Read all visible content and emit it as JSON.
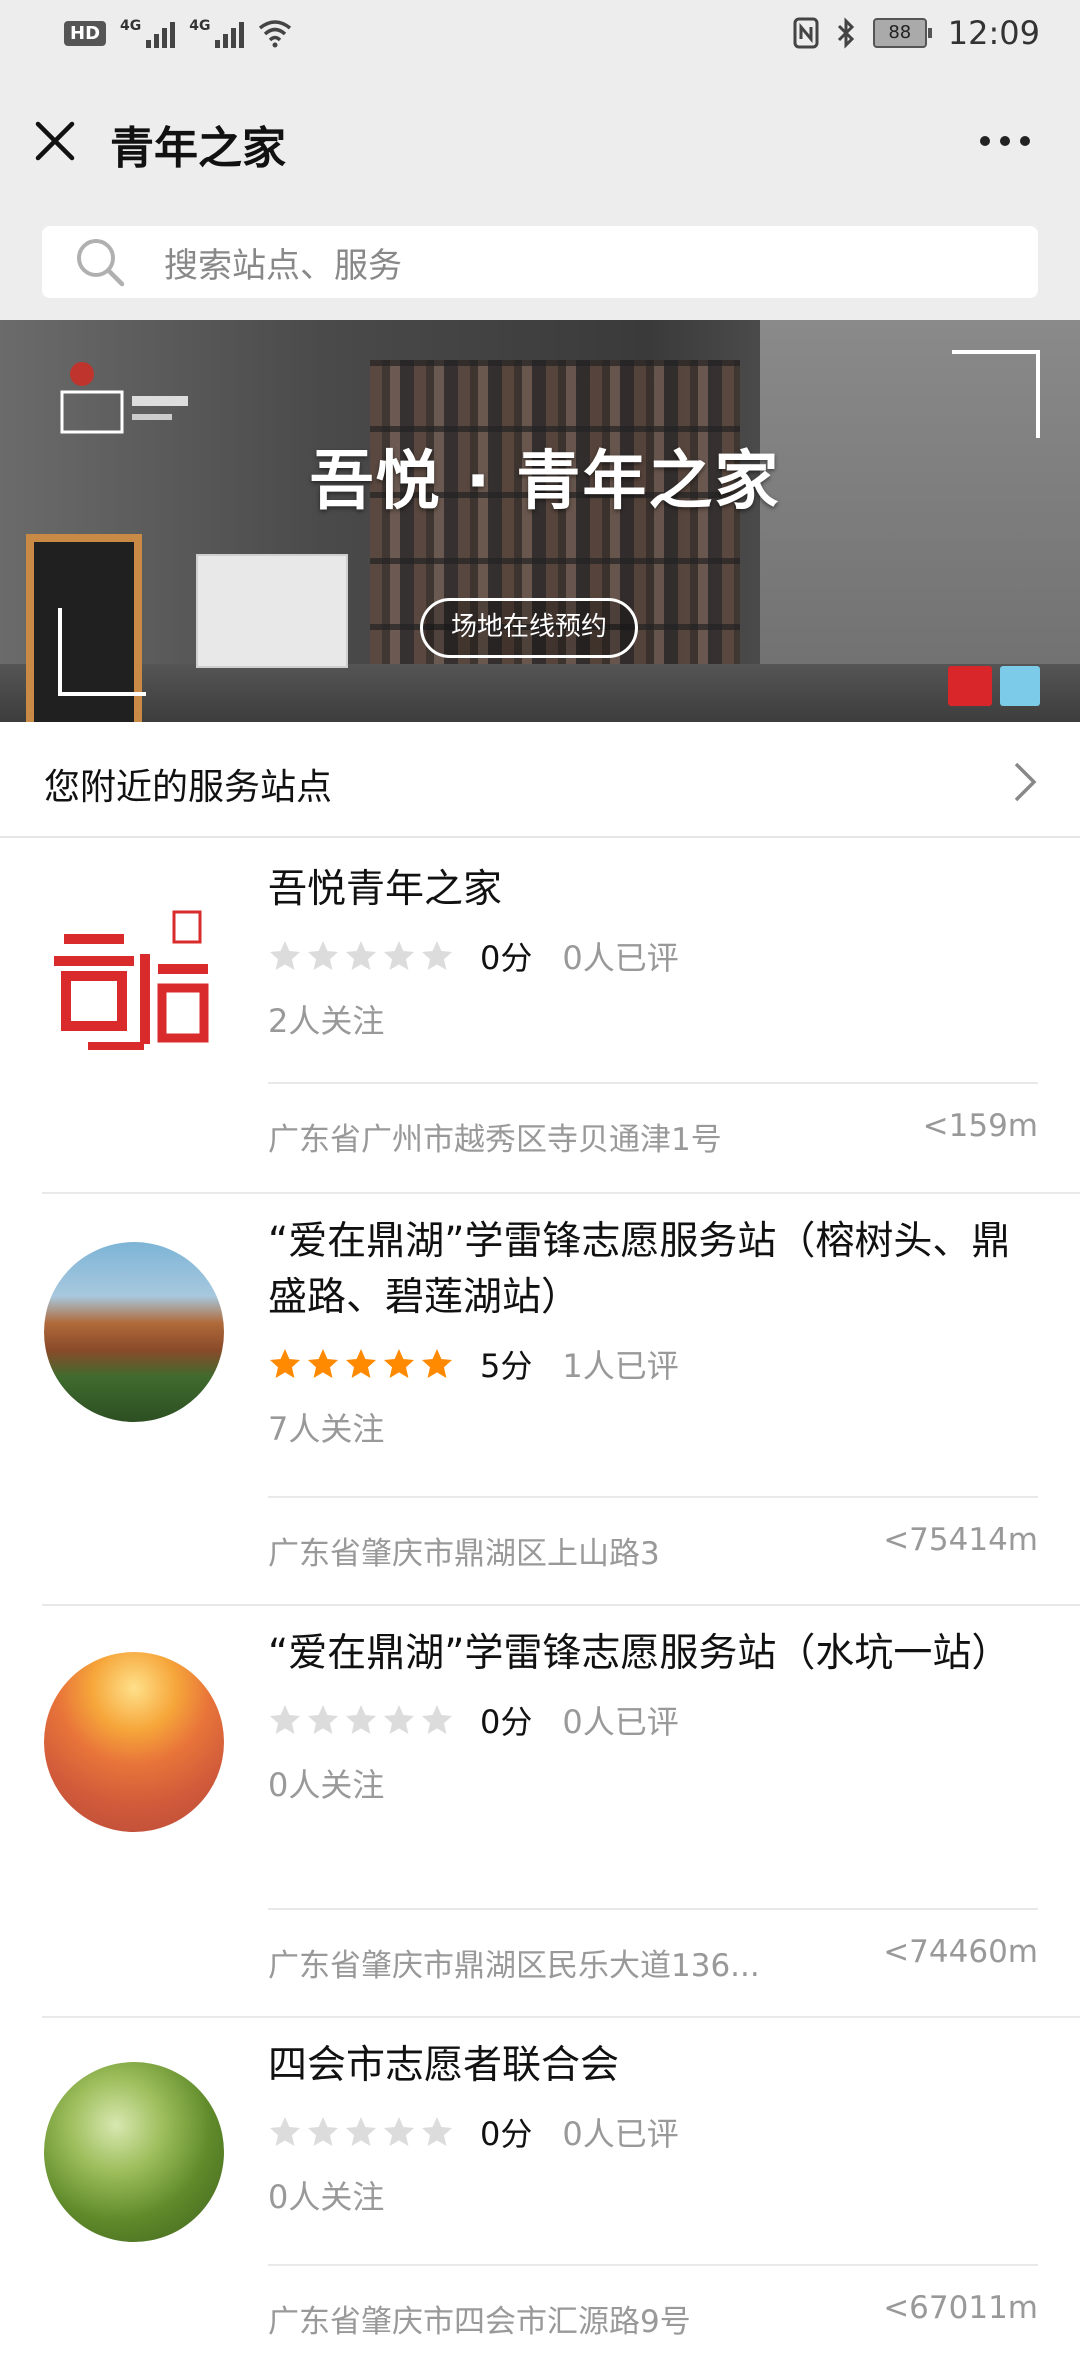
{
  "status_bar": {
    "hd_label": "HD",
    "sim1_label": "4G",
    "sim2_label": "4G",
    "battery": "88",
    "time": "12:09"
  },
  "nav": {
    "title": "青年之家"
  },
  "search": {
    "placeholder": "搜索站点、服务"
  },
  "banner": {
    "title": "吾悦 · 青年之家",
    "button_label": "场地在线预约"
  },
  "section": {
    "title": "您附近的服务站点"
  },
  "stations": [
    {
      "name": "吾悦青年之家",
      "stars_filled": 0,
      "score": "0分",
      "reviews": "0人已评",
      "follows": "2人关注",
      "address": "广东省广州市越秀区寺贝通津1号",
      "distance": "<159m"
    },
    {
      "name": "“爱在鼎湖”学雷锋志愿服务站（榕树头、鼎盛路、碧莲湖站）",
      "stars_filled": 5,
      "score": "5分",
      "reviews": "1人已评",
      "follows": "7人关注",
      "address": "广东省肇庆市鼎湖区上山路3",
      "distance": "<75414m"
    },
    {
      "name": "“爱在鼎湖”学雷锋志愿服务站（水坑一站）",
      "stars_filled": 0,
      "score": "0分",
      "reviews": "0人已评",
      "follows": "0人关注",
      "address": "广东省肇庆市鼎湖区民乐大道136...",
      "distance": "<74460m"
    },
    {
      "name": "四会市志愿者联合会",
      "stars_filled": 0,
      "score": "0分",
      "reviews": "0人已评",
      "follows": "0人关注",
      "address": "广东省肇庆市四会市汇源路9号",
      "distance": "<67011m"
    }
  ],
  "colors": {
    "star_on": "#ff8a00",
    "star_off": "#dcdcdc",
    "header_bg": "#ededed"
  }
}
